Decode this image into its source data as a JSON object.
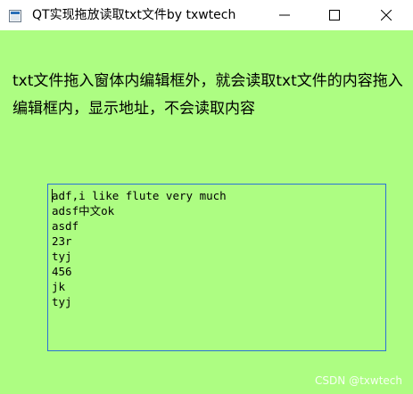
{
  "window": {
    "title": "QT实现拖放读取txt文件by txwtech",
    "background_color": "#adfd82",
    "buttons": {
      "minimize": "minimize-icon",
      "maximize": "maximize-icon",
      "close": "close-icon"
    }
  },
  "instruction": {
    "text": "txt文件拖入窗体内编辑框外，就会读取txt文件的内容拖入编辑框内，显示地址，不会读取内容"
  },
  "editor": {
    "border_color": "#2b72d7",
    "lines": [
      "adf,i like flute very much",
      "adsf中文ok",
      "asdf",
      "23r",
      "tyj",
      "456",
      "jk",
      "tyj"
    ]
  },
  "watermark": {
    "text": "CSDN @txwtech"
  }
}
